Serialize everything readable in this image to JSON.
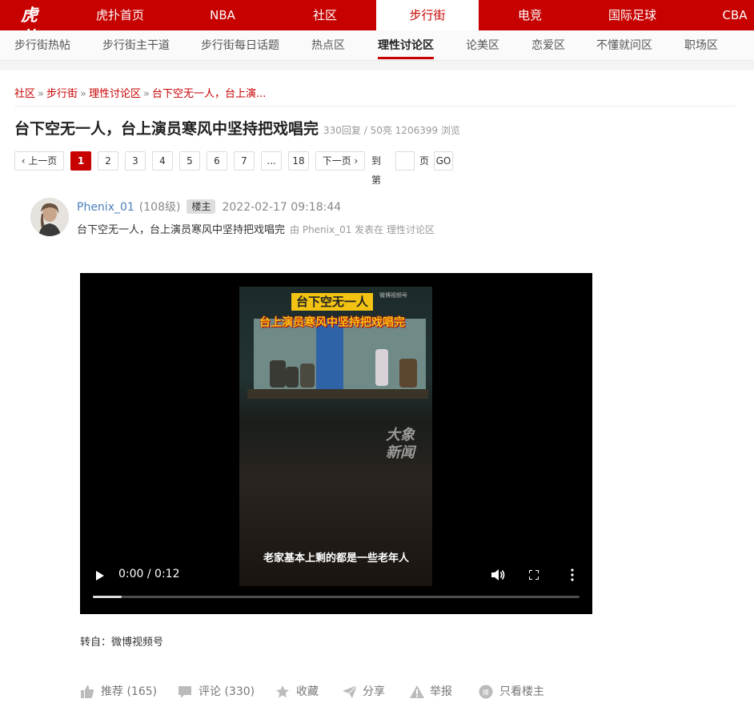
{
  "logo": {
    "text": "虎扑"
  },
  "topnav": {
    "items": [
      {
        "label": "虎扑首页"
      },
      {
        "label": "NBA"
      },
      {
        "label": "社区"
      },
      {
        "label": "步行街",
        "active": true
      },
      {
        "label": "电竞"
      },
      {
        "label": "国际足球"
      },
      {
        "label": "CBA"
      }
    ]
  },
  "subnav": {
    "items": [
      {
        "label": "步行街热帖"
      },
      {
        "label": "步行街主干道"
      },
      {
        "label": "步行街每日话题"
      },
      {
        "label": "热点区"
      },
      {
        "label": "理性讨论区",
        "active": true
      },
      {
        "label": "论美区"
      },
      {
        "label": "恋爱区"
      },
      {
        "label": "不懂就问区"
      },
      {
        "label": "职场区"
      }
    ]
  },
  "breadcrumb": [
    "社区",
    "步行街",
    "理性讨论区",
    "台下空无一人，台上演..."
  ],
  "breadcrumb_sep": "»",
  "thread": {
    "title": "台下空无一人，台上演员寒风中坚持把戏唱完",
    "stats": "330回复 / 50亮 1206399 浏览"
  },
  "pager": {
    "prev": "‹ 上一页",
    "pages": [
      "1",
      "2",
      "3",
      "4",
      "5",
      "6",
      "7",
      "...",
      "18"
    ],
    "current": "1",
    "next": "下一页 ›",
    "goto_prefix": "到第",
    "goto_suffix": "页",
    "go": "GO"
  },
  "post": {
    "username": "Phenix_01",
    "level": "(108级)",
    "badge": "楼主",
    "time": "2022-02-17 09:18:44",
    "subtitle": "台下空无一人，台上演员寒风中坚持把戏唱完",
    "posted_by": "由  Phenix_01 发表在  理性讨论区"
  },
  "video": {
    "overlay_title1": "台下空无一人",
    "overlay_title2": "台上演员寒风中坚持把戏唱完",
    "watermark": "微博视频号",
    "logo_text": "大象\n新闻",
    "caption": "老家基本上剩的都是一些老年人",
    "time": "0:00 / 0:12",
    "progress": 0.06
  },
  "source": "转自：微博视频号",
  "actions": [
    {
      "icon": "thumbs-up-icon",
      "label": "推荐 (165)"
    },
    {
      "icon": "comment-icon",
      "label": "评论 (330)"
    },
    {
      "icon": "star-icon",
      "label": "收藏"
    },
    {
      "icon": "share-icon",
      "label": "分享"
    },
    {
      "icon": "warning-icon",
      "label": "举报"
    },
    {
      "icon": "owner-only-icon",
      "label": "只看楼主"
    }
  ],
  "colors": {
    "brand": "#c60100",
    "link": "#4b7fbe",
    "muted": "#999999"
  }
}
